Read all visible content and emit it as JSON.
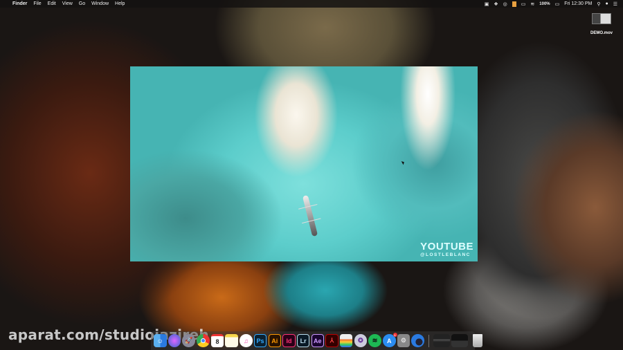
{
  "menubar": {
    "apple": "",
    "app": "Finder",
    "items": [
      "File",
      "Edit",
      "View",
      "Go",
      "Window",
      "Help"
    ],
    "battery": "100%",
    "clock": "Fri 12:30 PM"
  },
  "desktop": {
    "file_label": "DEMO.mov"
  },
  "video": {
    "watermark_title": "YOUTUBE",
    "watermark_handle": "@LOSTLEBLANC"
  },
  "overlay_watermark": "aparat.com/studiojazireh",
  "dock": {
    "calendar_day": "8",
    "appstore_badge": "1",
    "labels": {
      "ps": "Ps",
      "ai": "Ai",
      "id": "Id",
      "lr": "Lr",
      "ae": "Ae"
    }
  }
}
